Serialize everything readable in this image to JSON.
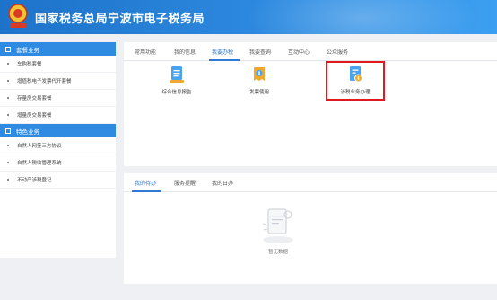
{
  "header": {
    "title": "国家税务总局宁波市电子税务局"
  },
  "sidebar": {
    "sections": [
      {
        "title": "套餐业务",
        "items": [
          "车购税套餐",
          "增值税电子发票代开套餐",
          "存量房交易套餐",
          "增量房交易套餐"
        ]
      },
      {
        "title": "特色业务",
        "items": [
          "自然人网签三方协议",
          "自然人税收管理系统",
          "不动产涉税登记"
        ]
      }
    ]
  },
  "top_panel": {
    "tabs": [
      "常用功能",
      "我的信息",
      "我要办税",
      "我要查询",
      "互动中心",
      "公众服务"
    ],
    "active_tab": "我要办税",
    "functions": [
      {
        "label": "综合信息报告",
        "icon": "report-icon"
      },
      {
        "label": "发票使用",
        "icon": "invoice-icon"
      },
      {
        "label": "涉税业务办理",
        "icon": "tax-business-icon"
      }
    ]
  },
  "bottom_panel": {
    "tabs": [
      "我的待办",
      "服务提醒",
      "我的日办"
    ],
    "active_tab": "我的待办",
    "empty_text": "暂无数据"
  },
  "colors": {
    "accent": "#2f78d4",
    "header": "#2d8ae0",
    "highlight": "#e0191f"
  }
}
